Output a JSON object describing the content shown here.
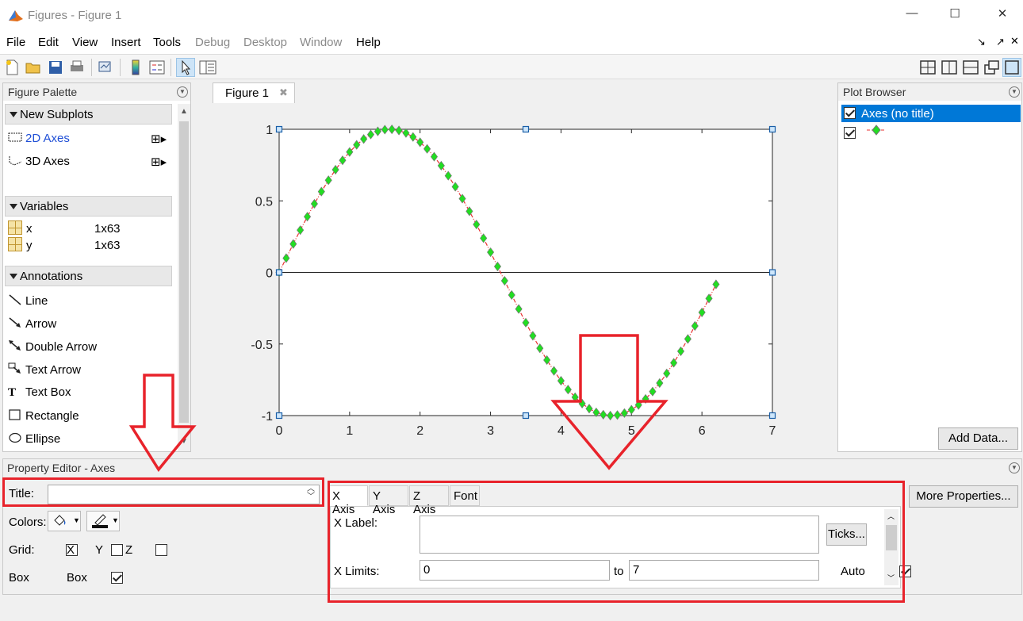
{
  "window": {
    "title": "Figures - Figure 1",
    "minimize": "—",
    "maximize": "☐",
    "close": "✕"
  },
  "menu": [
    {
      "label": "File",
      "enabled": true
    },
    {
      "label": "Edit",
      "enabled": true
    },
    {
      "label": "View",
      "enabled": true
    },
    {
      "label": "Insert",
      "enabled": true
    },
    {
      "label": "Tools",
      "enabled": true
    },
    {
      "label": "Debug",
      "enabled": false
    },
    {
      "label": "Desktop",
      "enabled": false
    },
    {
      "label": "Window",
      "enabled": false
    },
    {
      "label": "Help",
      "enabled": true
    }
  ],
  "palette": {
    "title": "Figure Palette",
    "new_subplots": "New Subplots",
    "axes2d": "2D Axes",
    "axes3d": "3D Axes",
    "variables": "Variables",
    "vars": [
      {
        "name": "x",
        "size": "1x63"
      },
      {
        "name": "y",
        "size": "1x63"
      }
    ],
    "annotations": "Annotations",
    "annot": [
      "Line",
      "Arrow",
      "Double Arrow",
      "Text Arrow",
      "Text Box",
      "Rectangle",
      "Ellipse"
    ]
  },
  "figure_tab": {
    "label": "Figure 1",
    "close": "✖"
  },
  "chart_data": {
    "type": "line",
    "series": [
      {
        "function": "sin(x)",
        "x_start": 0,
        "x_step": 0.1,
        "count": 63,
        "marker": "diamond",
        "marker_color": "#22dd22",
        "marker_edge": "#777777",
        "line_color": "#e83030",
        "line_style": "dash-dot"
      }
    ],
    "xlim": [
      0,
      7
    ],
    "ylim": [
      -1,
      1
    ],
    "xticks": [
      "0",
      "1",
      "2",
      "3",
      "4",
      "5",
      "6",
      "7"
    ],
    "yticks": [
      "1",
      "0.5",
      "0",
      "-0.5",
      "-1"
    ],
    "baseline_y": 0
  },
  "plot_browser": {
    "title": "Plot Browser",
    "axes_label": "Axes (no title)",
    "add_data": "Add Data..."
  },
  "prop_editor": {
    "title": "Property Editor - Axes",
    "title_label": "Title:",
    "title_value": "",
    "colors_label": "Colors:",
    "grid_label": "Grid:",
    "grid_x": "X",
    "grid_y": "Y",
    "grid_z": "Z",
    "box_label": "Box",
    "box_check": "Box",
    "tabs": [
      "X Axis",
      "Y Axis",
      "Z Axis",
      "Font"
    ],
    "xlabel_label": "X Label:",
    "xlabel_value": "",
    "ticks_btn": "Ticks...",
    "xlimits_label": "X Limits:",
    "xlim_from": "0",
    "xlim_to": "7",
    "to_label": "to",
    "auto_label": "Auto",
    "more_props": "More Properties..."
  },
  "colors": {
    "accent": "#0078d7",
    "annotation_red": "#e8232b"
  }
}
